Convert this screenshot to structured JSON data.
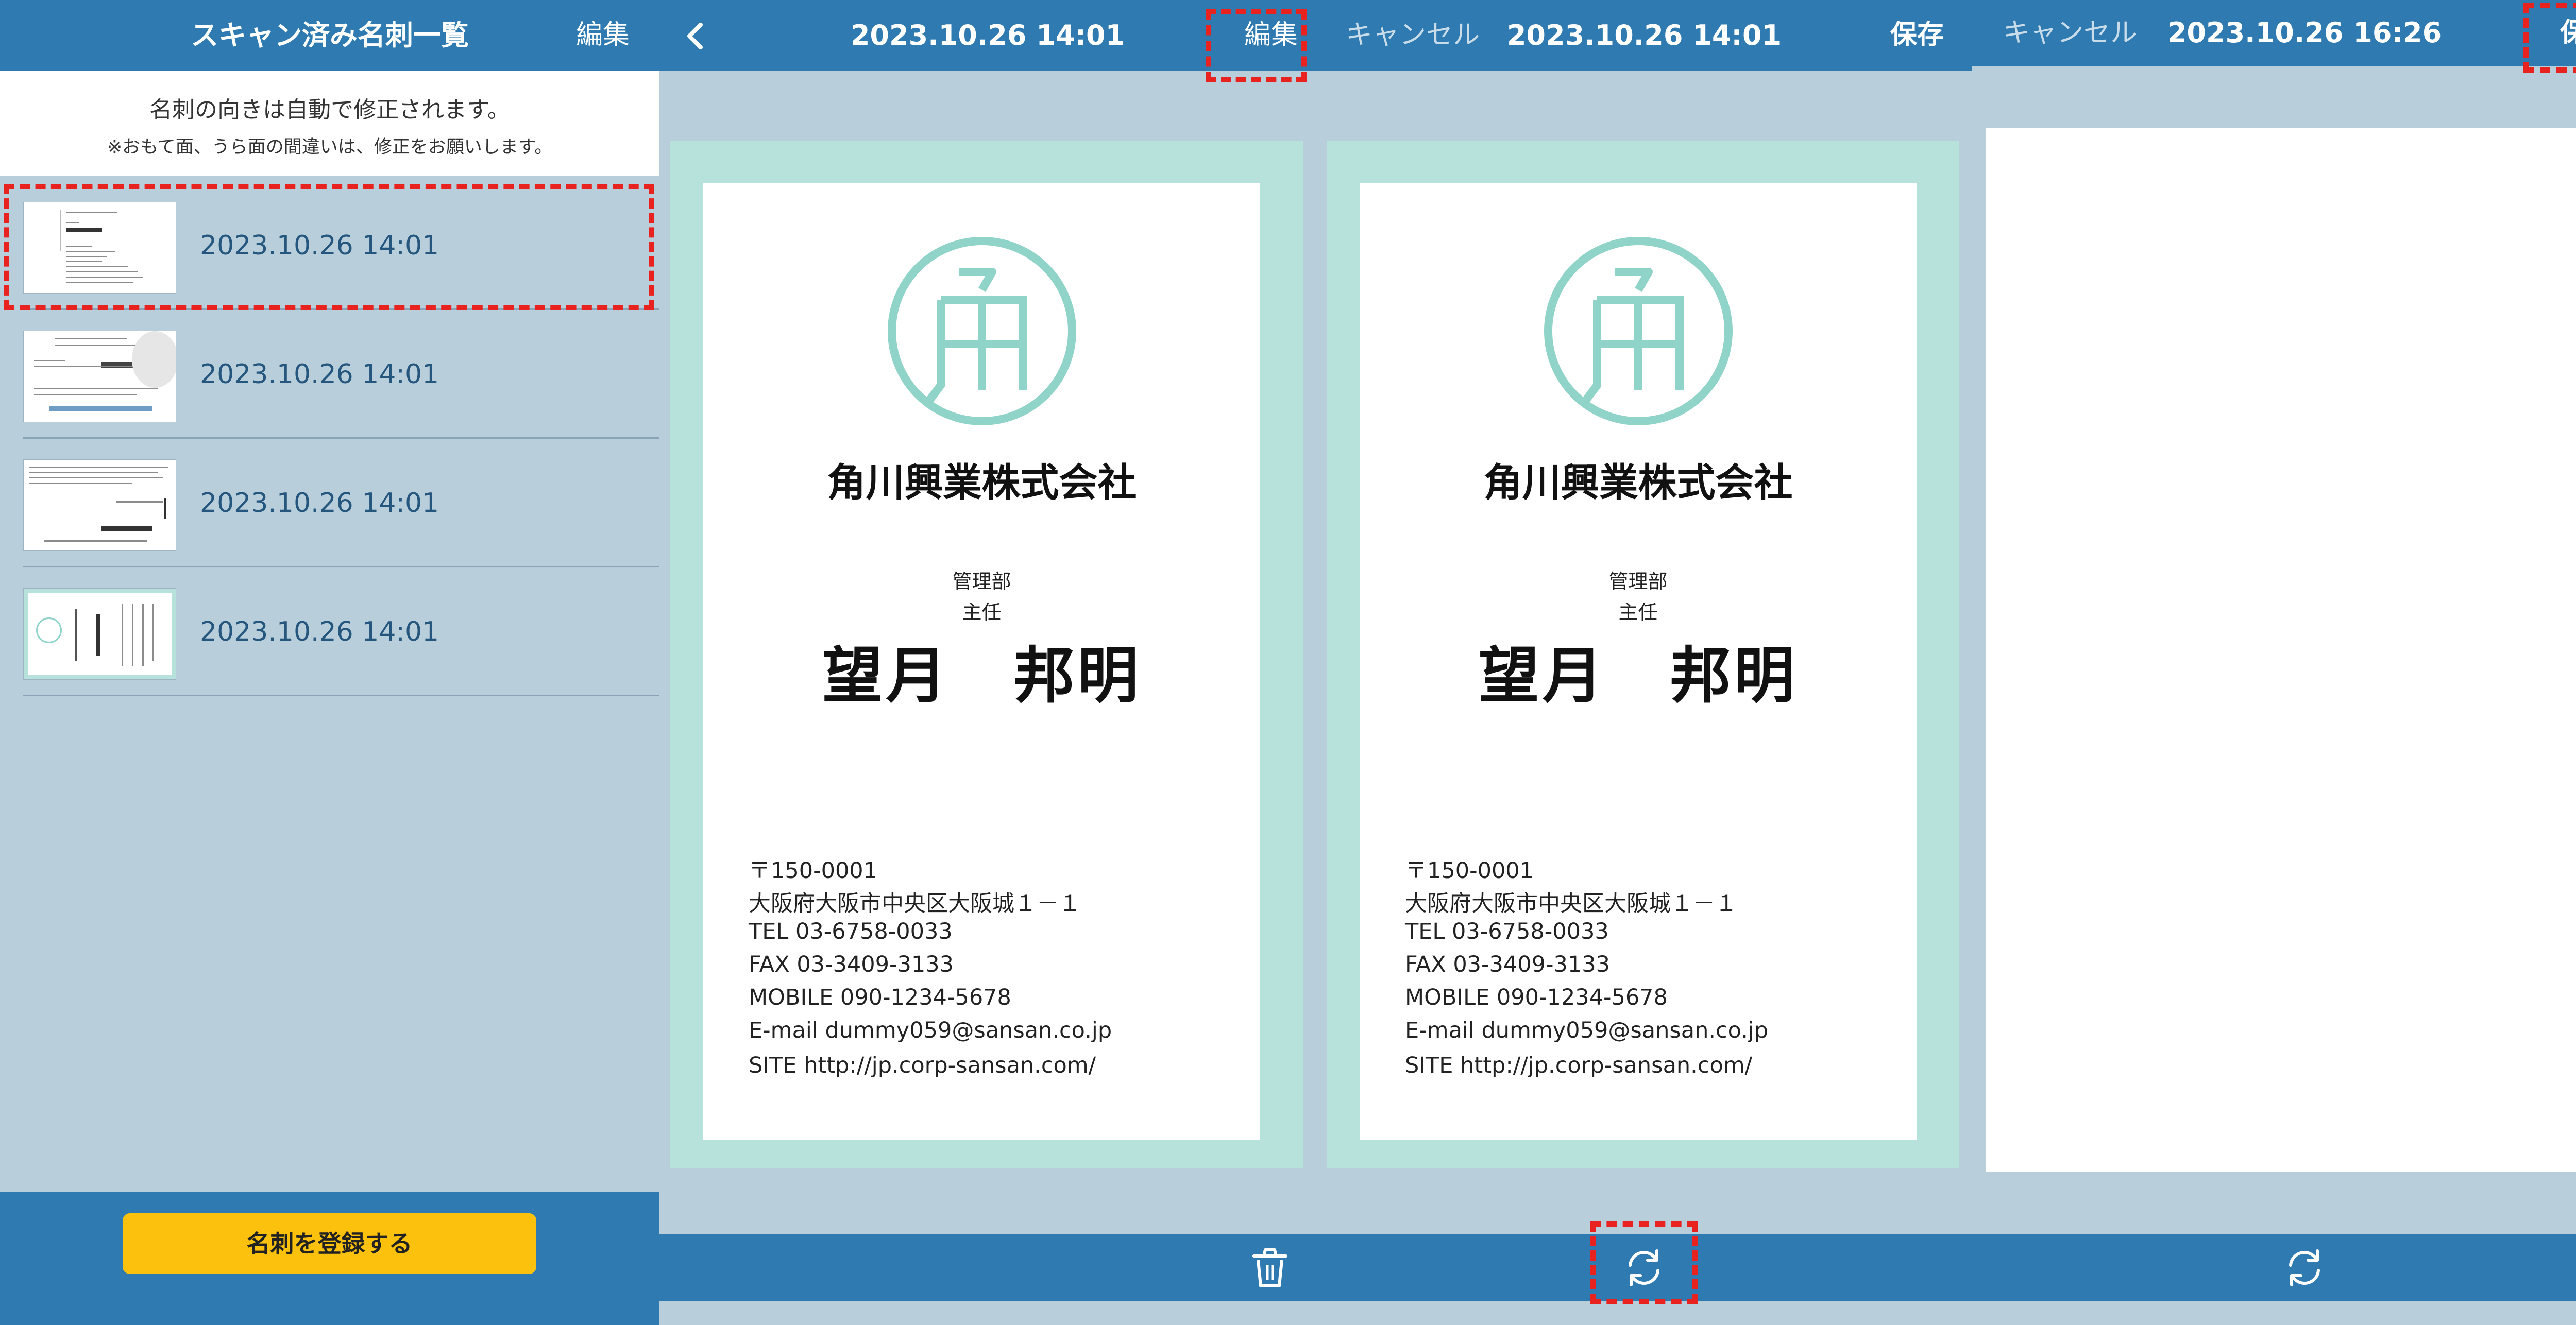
{
  "list_screen": {
    "title": "スキャン済み名刺一覧",
    "edit_label": "編集",
    "notice_main": "名刺の向きは自動で修正されます。",
    "notice_sub": "※おもて面、うら面の間違いは、修正をお願いします。",
    "rows": [
      {
        "date": "2023.10.26 14:01",
        "highlighted": true
      },
      {
        "date": "2023.10.26 14:01"
      },
      {
        "date": "2023.10.26 14:01"
      },
      {
        "date": "2023.10.26 14:01"
      }
    ],
    "register_button": "名刺を登録する"
  },
  "detail_screen": {
    "back_icon": "chevron-left-icon",
    "title": "2023.10.26 14:01",
    "edit_label": "編集",
    "toolbar_icon": "trash-icon"
  },
  "edit_screen": {
    "cancel_label": "キャンセル",
    "title": "2023.10.26 14:01",
    "save_label": "保存",
    "toolbar_icon": "rotate-icon"
  },
  "edit_screen_2": {
    "cancel_label": "キャンセル",
    "title": "2023.10.26 16:26",
    "save_label": "保存",
    "toolbar_icon": "rotate-icon"
  },
  "card": {
    "company": "角川興業株式会社",
    "department": "管理部",
    "position": "主任",
    "name": "望月　邦明",
    "postal": "〒150-0001",
    "address": "大阪府大阪市中央区大阪城１－１",
    "tel": "TEL 03-6758-0033",
    "fax": "FAX 03-3409-3133",
    "mobile": "MOBILE 090-1234-5678",
    "email": "E-mail dummy059@sansan.co.jp",
    "site": "SITE http://jp.corp-sansan.com/"
  },
  "colors": {
    "navbar": "#2f7bb1",
    "background": "#b9cedb",
    "accent_button": "#fbc10c",
    "highlight": "#e8231f",
    "card_border": "#b7e2dc",
    "logo": "#8fd3c9"
  }
}
